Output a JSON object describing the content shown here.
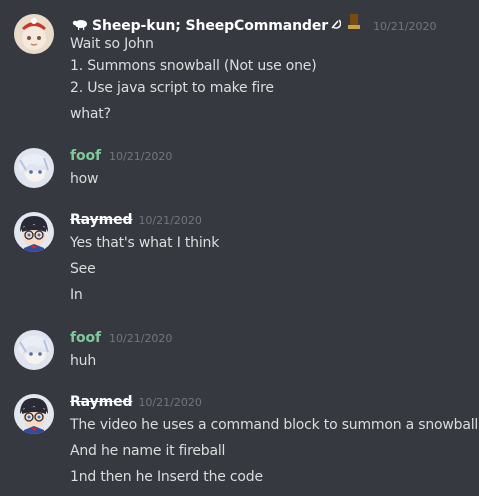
{
  "messages": [
    {
      "username": "Sheep-kun; SheepCommander",
      "timestamp": "10/21/2020",
      "lines": [
        "Wait so John",
        " 1. Summons snowball (Not use one)",
        " 2. Use java script to make fire",
        "what?"
      ]
    },
    {
      "username": "foof",
      "timestamp": "10/21/2020",
      "lines": [
        "how"
      ]
    },
    {
      "username": "Raymed",
      "timestamp": "10/21/2020",
      "lines": [
        "Yes that's what I think",
        "See",
        "In"
      ]
    },
    {
      "username": "foof",
      "timestamp": "10/21/2020",
      "lines": [
        "huh"
      ]
    },
    {
      "username": "Raymed",
      "timestamp": "10/21/2020",
      "lines": [
        "The video he uses a command block to summon a snowball",
        "And he name it fireball",
        "1nd then he Inserd the code"
      ]
    }
  ],
  "colors": {
    "background": "#36393f",
    "message_text": "#dcddde",
    "timestamp": "#72767d",
    "username_default": "#ffffff",
    "username_foof": "#7fc99a"
  },
  "icons": {
    "sheep": "sheep-icon",
    "hammer_sickle": "hammer-sickle-icon",
    "boot": "boot-icon"
  }
}
